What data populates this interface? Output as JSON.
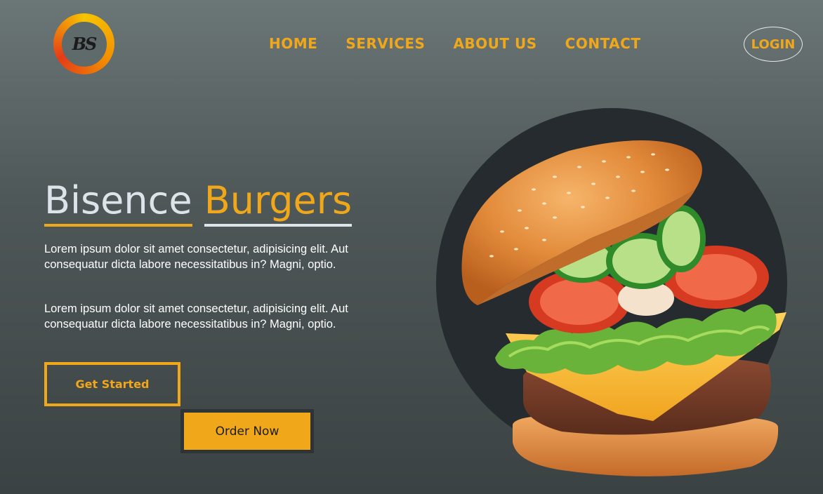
{
  "logo": {
    "text": "BS"
  },
  "nav": {
    "items": [
      {
        "label": "HOME"
      },
      {
        "label": "SERVICES"
      },
      {
        "label": "ABOUT US"
      },
      {
        "label": "CONTACT"
      }
    ],
    "login_label": "LOGIN"
  },
  "hero": {
    "title_first": "Bisence",
    "title_second": "Burgers",
    "paragraph_1": "Lorem ipsum dolor sit amet consectetur, adipisicing elit. Aut consequatur dicta labore necessitatibus in? Magni, optio.",
    "paragraph_2": "Lorem ipsum dolor sit amet consectetur, adipisicing elit. Aut consequatur dicta labore necessitatibus in? Magni, optio.",
    "get_started_label": "Get Started",
    "order_now_label": "Order Now"
  },
  "colors": {
    "accent": "#f0a81a",
    "title_light": "#dce4ea",
    "circle_bg": "#252b2f"
  }
}
